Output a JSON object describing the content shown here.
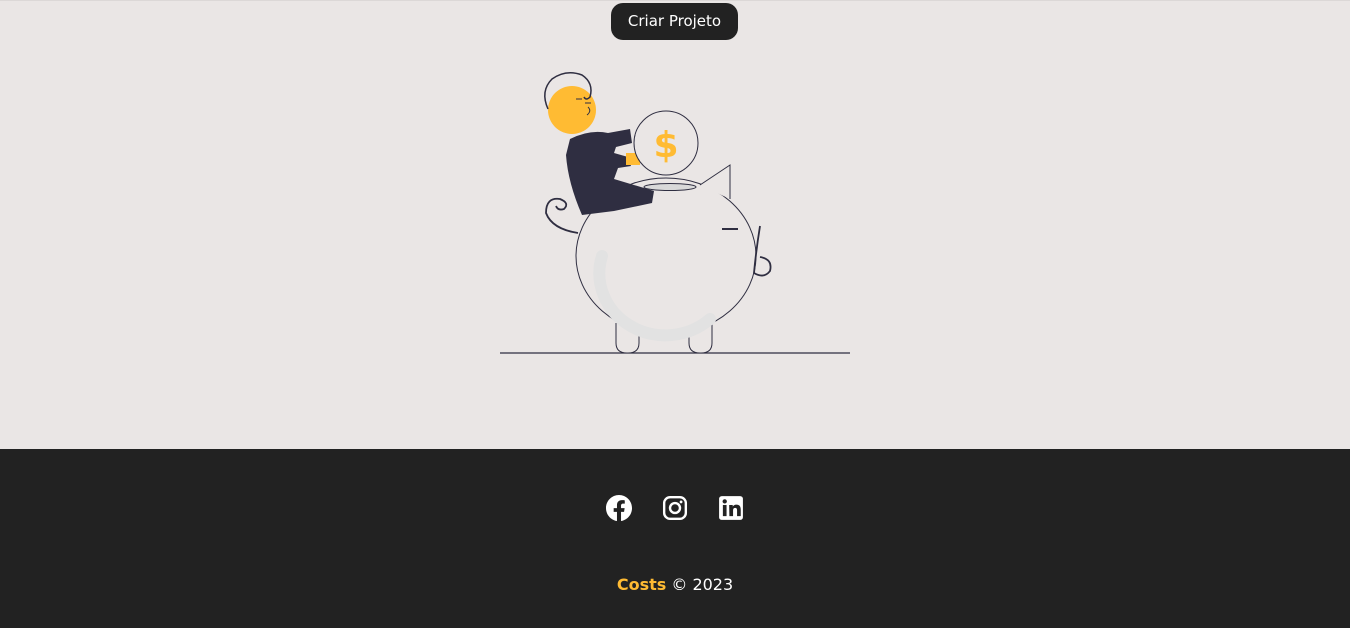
{
  "main": {
    "cta_label": "Criar Projeto"
  },
  "footer": {
    "social": [
      {
        "name": "facebook-icon"
      },
      {
        "name": "instagram-icon"
      },
      {
        "name": "linkedin-icon"
      }
    ],
    "brand": "Costs",
    "copyright": "© 2023"
  },
  "colors": {
    "accent": "#ffbb33",
    "dark": "#222222",
    "background": "#eae6e5",
    "figure_navy": "#2f2e41"
  }
}
